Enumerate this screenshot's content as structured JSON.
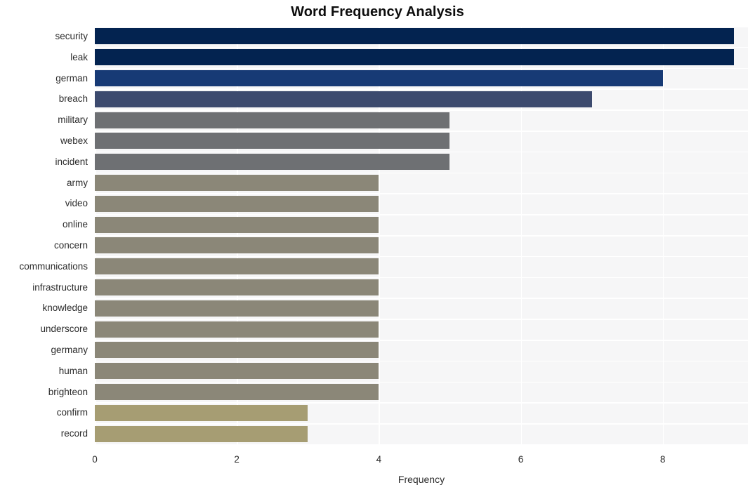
{
  "chart_data": {
    "type": "bar",
    "orientation": "horizontal",
    "title": "Word Frequency Analysis",
    "xlabel": "Frequency",
    "ylabel": "",
    "xlim": [
      0,
      9.2
    ],
    "xticks": [
      "0",
      "2",
      "4",
      "6",
      "8"
    ],
    "xtick_values": [
      0,
      2,
      4,
      6,
      8
    ],
    "grid": true,
    "grid_color": "#ffffff",
    "plot_background": "#f6f6f7",
    "legend": "none",
    "categories": [
      "security",
      "leak",
      "german",
      "breach",
      "military",
      "webex",
      "incident",
      "army",
      "video",
      "online",
      "concern",
      "communications",
      "infrastructure",
      "knowledge",
      "underscore",
      "germany",
      "human",
      "brighteon",
      "confirm",
      "record"
    ],
    "values": [
      9,
      9,
      8,
      7,
      5,
      5,
      5,
      4,
      4,
      4,
      4,
      4,
      4,
      4,
      4,
      4,
      4,
      4,
      3,
      3
    ],
    "bar_colors": [
      "#032350",
      "#032350",
      "#173a75",
      "#3c4a6e",
      "#6e7073",
      "#6e7073",
      "#6e7073",
      "#8b8778",
      "#8b8778",
      "#8b8778",
      "#8b8778",
      "#8b8778",
      "#8b8778",
      "#8b8778",
      "#8b8778",
      "#8b8778",
      "#8b8778",
      "#8b8778",
      "#a69d73",
      "#a69d73"
    ]
  }
}
